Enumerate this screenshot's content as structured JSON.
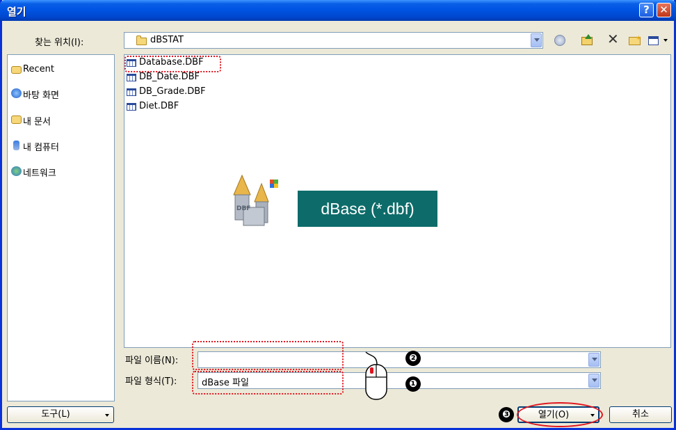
{
  "window": {
    "title": "열기",
    "help_symbol": "?",
    "close_symbol": "✕"
  },
  "lookin": {
    "label": "찾는 위치(I):",
    "value": "dBSTAT"
  },
  "toolbar": {
    "icons": [
      "back-icon",
      "up-folder-icon",
      "delete-icon",
      "new-folder-icon",
      "views-icon"
    ]
  },
  "places": [
    {
      "label": "Recent",
      "icon": "recent-folder-icon"
    },
    {
      "label": "바탕 화면",
      "icon": "desktop-icon"
    },
    {
      "label": "내 문서",
      "icon": "my-documents-icon"
    },
    {
      "label": "내 컴퓨터",
      "icon": "my-computer-icon"
    },
    {
      "label": "네트워크",
      "icon": "network-icon"
    }
  ],
  "files": [
    "Database.DBF",
    "DB_Date.DBF",
    "DB_Grade.DBF",
    "Diet.DBF"
  ],
  "overlay": {
    "format_caption": "dBase (*.dbf)",
    "step1": "❶",
    "step2": "❷",
    "step3": "❸"
  },
  "filename": {
    "label": "파일 이름(N):",
    "value": ""
  },
  "filetype": {
    "label": "파일 형식(T):",
    "value": "dBase 파일"
  },
  "buttons": {
    "tools": "도구(L)",
    "open": "열기(O)",
    "cancel": "취소"
  },
  "colors": {
    "title_bar": "#0054e3",
    "highlight": "#e0141e",
    "caption_bg": "#0d6c6a"
  }
}
